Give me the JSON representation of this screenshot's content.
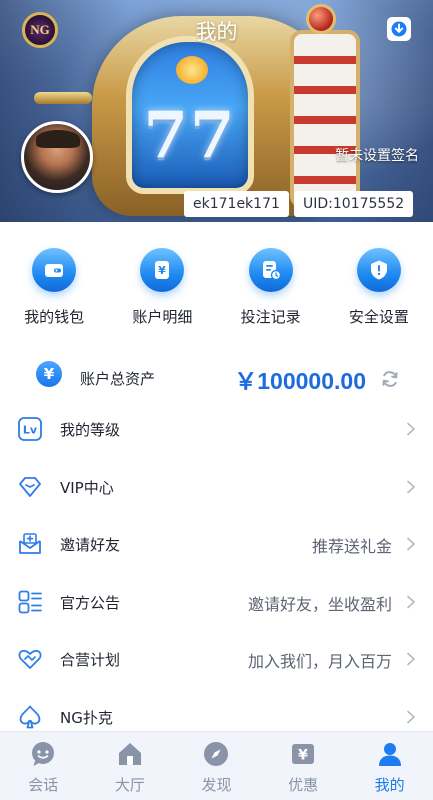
{
  "header": {
    "title": "我的",
    "logo_text": "NG",
    "signature": "暂未设置签名",
    "username": "ek171ek171",
    "uid": "UID:10175552",
    "banner_digits": "77"
  },
  "quick_actions": [
    {
      "label": "我的钱包",
      "icon": "wallet-icon"
    },
    {
      "label": "账户明细",
      "icon": "yen-bill-icon"
    },
    {
      "label": "投注记录",
      "icon": "bet-record-icon"
    },
    {
      "label": "安全设置",
      "icon": "shield-icon"
    }
  ],
  "balance": {
    "label": "账户总资产",
    "value": "￥100000.00",
    "icon_symbol": "¥"
  },
  "menu": [
    {
      "label": "我的等级",
      "extra": "",
      "icon": "level-icon"
    },
    {
      "label": "VIP中心",
      "extra": "",
      "icon": "diamond-icon"
    },
    {
      "label": "邀请好友",
      "extra": "推荐送礼金",
      "icon": "invite-envelope-icon"
    },
    {
      "label": "官方公告",
      "extra": "邀请好友，坐收盈利",
      "icon": "announcement-grid-icon"
    },
    {
      "label": "合营计划",
      "extra": "加入我们，月入百万",
      "icon": "handshake-heart-icon"
    },
    {
      "label": "NG扑克",
      "extra": "",
      "icon": "spade-icon"
    }
  ],
  "bottom_nav": [
    {
      "label": "会话",
      "icon": "chat-icon",
      "active": false
    },
    {
      "label": "大厅",
      "icon": "home-icon",
      "active": false
    },
    {
      "label": "发现",
      "icon": "compass-icon",
      "active": false
    },
    {
      "label": "优惠",
      "icon": "promo-icon",
      "active": false
    },
    {
      "label": "我的",
      "icon": "profile-icon",
      "active": true
    }
  ],
  "colors": {
    "accent": "#1d7cf2",
    "balance_text": "#1d6be0",
    "nav_inactive": "#8a94a8"
  }
}
